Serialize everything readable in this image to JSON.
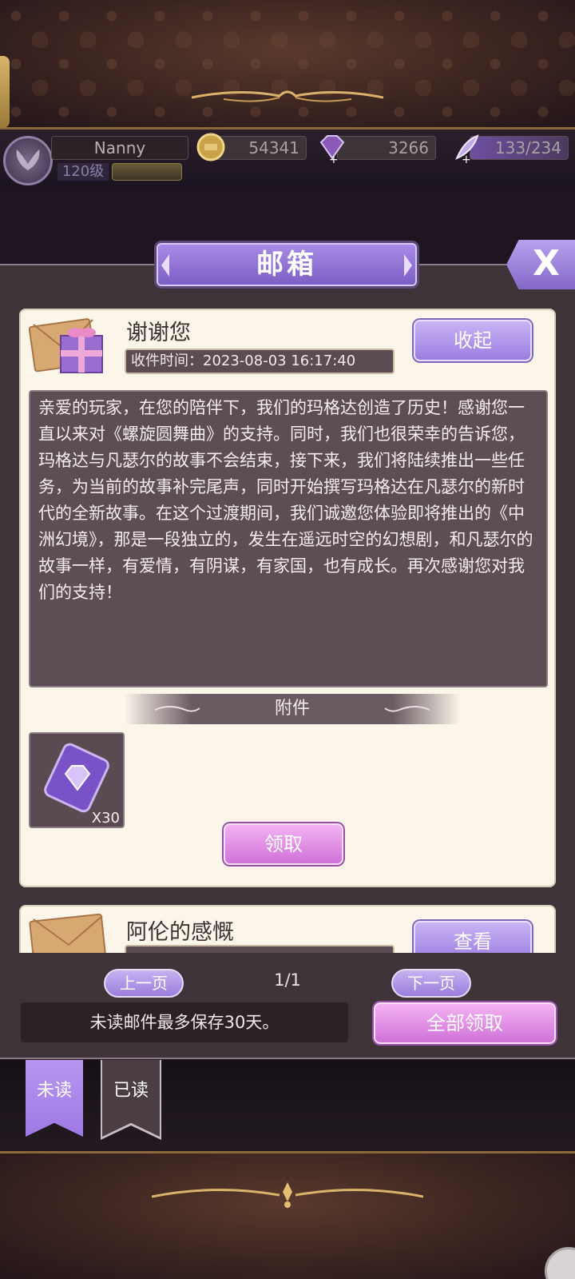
{
  "hud": {
    "player_name": "Nanny",
    "level": "120级",
    "gold": "54341",
    "gems": "3266",
    "energy": "133/234"
  },
  "mailbox": {
    "title": "邮箱",
    "close_label": "X"
  },
  "mails": [
    {
      "title": "谢谢您",
      "received_time": "收件时间：2023-08-03 16:17:40",
      "toggle_label": "收起",
      "body": "亲爱的玩家，在您的陪伴下，我们的玛格达创造了历史！感谢您一直以来对《螺旋圆舞曲》的支持。同时，我们也很荣幸的告诉您，玛格达与凡瑟尔的故事不会结束，接下来，我们将陆续推出一些任务，为当前的故事补完尾声，同时开始撰写玛格达在凡瑟尔的新时代的全新故事。在这个过渡期间，我们诚邀您体验即将推出的《中洲幻境》，那是一段独立的，发生在遥远时空的幻想剧，和凡瑟尔的故事一样，有爱情，有阴谋，有家国，也有成长。再次感谢您对我们的支持！",
      "attachment_header": "附件",
      "attachment_item": {
        "icon": "gem-ticket-icon",
        "quantity": "X30"
      },
      "claim_label": "领取"
    },
    {
      "title": "阿伦的感慨",
      "view_label": "查看"
    }
  ],
  "pager": {
    "prev_label": "上一页",
    "page": "1/1",
    "next_label": "下一页"
  },
  "footer": {
    "notice": "未读邮件最多保存30天。",
    "claim_all_label": "全部领取"
  },
  "tabs": {
    "unread": "未读",
    "read": "已读"
  },
  "colors": {
    "accent_purple": "#9d78e4",
    "accent_pink": "#cf72d9",
    "panel_bg": "#3e3338",
    "card_bg": "#fbf5ea"
  }
}
